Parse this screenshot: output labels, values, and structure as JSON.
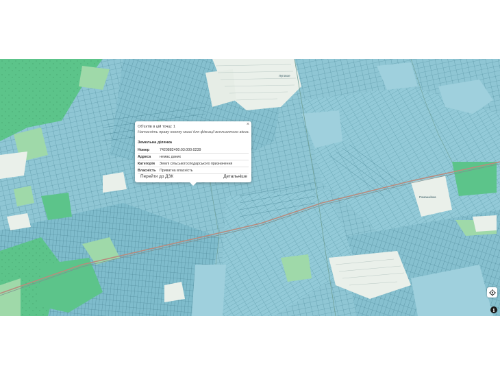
{
  "map": {
    "colors": {
      "parcel_fill": "#8fc6d4",
      "parcel_line": "#4f8c9c",
      "forest": "#5cc48a",
      "forest_light": "#9fd9a9",
      "settlement": "#eaf0ea",
      "road": "#c48a7a",
      "rail": "#7d8f8f"
    },
    "place_labels": [
      "Луговое",
      "Ромашківка"
    ]
  },
  "popup": {
    "close_label": "×",
    "objects_count": "Об'єктів в цій точці: 1",
    "hint": "Натисніть праву кнопку миші для фіксації всплиаючого вікна.",
    "section_title": "Земельна ділянка",
    "rows": [
      {
        "key": "Номер",
        "value": "7420882400:03:000:0239"
      },
      {
        "key": "Адреса",
        "value": "немає даних"
      },
      {
        "key": "Категорія",
        "value": "Землі сільськогосподарського призначення"
      },
      {
        "key": "Власність",
        "value": "Приватна власність"
      }
    ],
    "btn_dzk": "Перейти до ДЗК",
    "btn_details": "Детальніше"
  },
  "controls": {
    "locate_icon": "crosshair-icon",
    "info_label": "i"
  }
}
